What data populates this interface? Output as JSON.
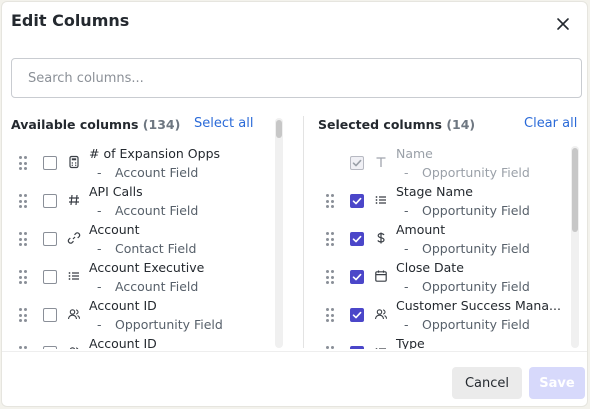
{
  "dialog": {
    "title": "Edit Columns",
    "close_icon": "close-icon"
  },
  "search": {
    "placeholder": "Search columns...",
    "value": ""
  },
  "available": {
    "title": "Available columns",
    "count": "(134)",
    "action": "Select all",
    "items": [
      {
        "name": "# of Expansion Opps",
        "source": "Account Field",
        "icon": "calculator-icon"
      },
      {
        "name": "API Calls",
        "source": "Account Field",
        "icon": "hash-icon"
      },
      {
        "name": "Account",
        "source": "Contact Field",
        "icon": "link-icon"
      },
      {
        "name": "Account Executive",
        "source": "Account Field",
        "icon": "list-icon"
      },
      {
        "name": "Account ID",
        "source": "Opportunity Field",
        "icon": "users-icon"
      },
      {
        "name": "Account ID",
        "source": "",
        "icon": "users-icon"
      }
    ]
  },
  "selected": {
    "title": "Selected columns",
    "count": "(14)",
    "action": "Clear all",
    "items": [
      {
        "name": "Name",
        "source": "Opportunity Field",
        "icon": "text-icon",
        "locked": true
      },
      {
        "name": "Stage Name",
        "source": "Opportunity Field",
        "icon": "list-icon"
      },
      {
        "name": "Amount",
        "source": "Opportunity Field",
        "icon": "dollar-icon"
      },
      {
        "name": "Close Date",
        "source": "Opportunity Field",
        "icon": "calendar-icon"
      },
      {
        "name": "Customer Success Mana...",
        "source": "Opportunity Field",
        "icon": "users-icon"
      },
      {
        "name": "Type",
        "source": "",
        "icon": "list-icon"
      }
    ]
  },
  "footer": {
    "cancel_label": "Cancel",
    "save_label": "Save"
  },
  "colors": {
    "accent": "#4b46c9",
    "link": "#2a6ad8",
    "save_disabled": "#d7d9fb"
  }
}
